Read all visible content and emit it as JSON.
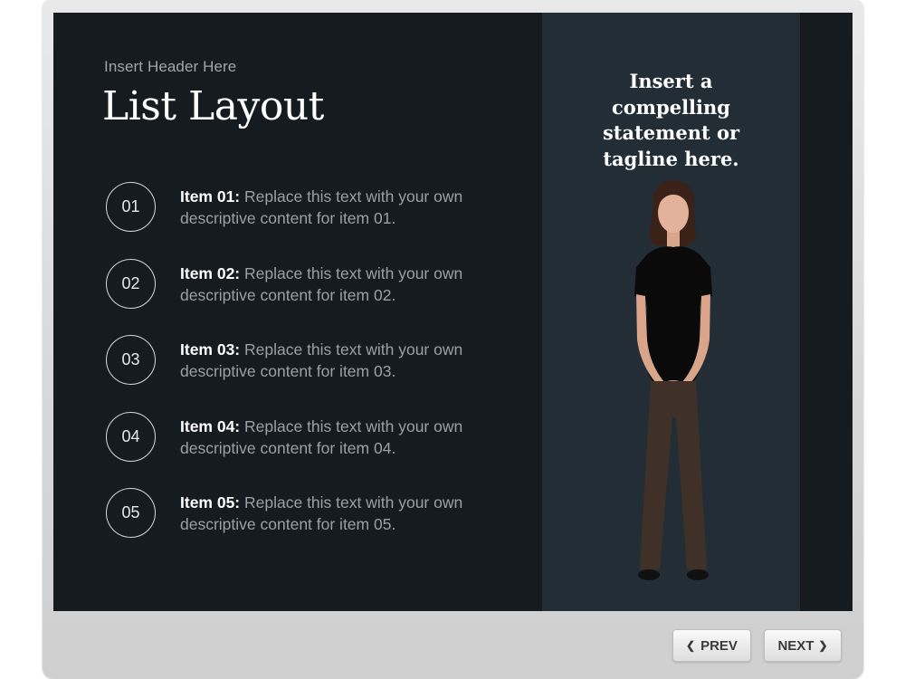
{
  "slide": {
    "header": "Insert Header Here",
    "title": "List Layout",
    "tagline_lines": [
      "Insert a",
      "compelling",
      "statement or",
      "tagline here."
    ],
    "items": [
      {
        "number": "01",
        "label": "Item 01:",
        "text": " Replace this text with your own descriptive content for item 01."
      },
      {
        "number": "02",
        "label": "Item 02:",
        "text": " Replace this text with your own descriptive content for item 02."
      },
      {
        "number": "03",
        "label": "Item 03:",
        "text": " Replace this text with your own descriptive content for item 03."
      },
      {
        "number": "04",
        "label": "Item 04:",
        "text": " Replace this text with your own descriptive content for item 04."
      },
      {
        "number": "05",
        "label": "Item 05:",
        "text": " Replace this text with your own descriptive content for item 05."
      }
    ]
  },
  "nav": {
    "prev_label": "PREV",
    "next_label": "NEXT",
    "prev_icon": "chevron-left-icon",
    "next_icon": "chevron-right-icon"
  },
  "colors": {
    "slide_background": "#161b20",
    "side_panel": "#232d35",
    "title": "#ffffff",
    "body_text": "#9aa0a5"
  }
}
